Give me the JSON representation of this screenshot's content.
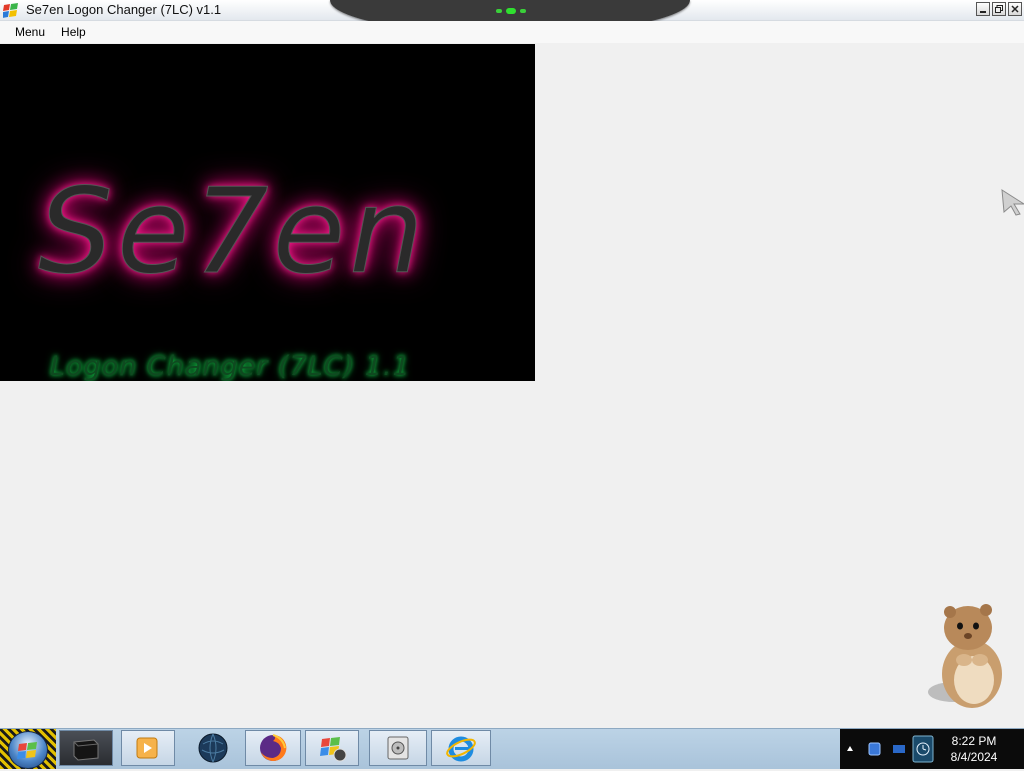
{
  "window": {
    "title": "Se7en Logon Changer (7LC) v1.1",
    "buttons": {
      "minimize": "minimize-icon",
      "restore": "restore-icon",
      "close": "close-icon"
    }
  },
  "menu": [
    {
      "label": "Menu"
    },
    {
      "label": "Help"
    }
  ],
  "splash": {
    "title": "Se7en",
    "subtitle": "Logon Changer (7LC) 1.1",
    "title_glow_color": "#ff1f8f",
    "subtitle_color": "#16c84a"
  },
  "taskbar": {
    "start": {
      "icon": "windows-orb-icon"
    },
    "items": [
      {
        "icon": "terminal-icon"
      },
      {
        "icon": "media-player-icon"
      },
      {
        "icon": "globe-icon"
      },
      {
        "icon": "firefox-icon"
      },
      {
        "icon": "windows-flag-icon"
      },
      {
        "icon": "disk-icon"
      },
      {
        "icon": "internet-explorer-icon"
      }
    ],
    "tray": {
      "time": "8:22 PM",
      "date": "8/4/2024"
    }
  }
}
